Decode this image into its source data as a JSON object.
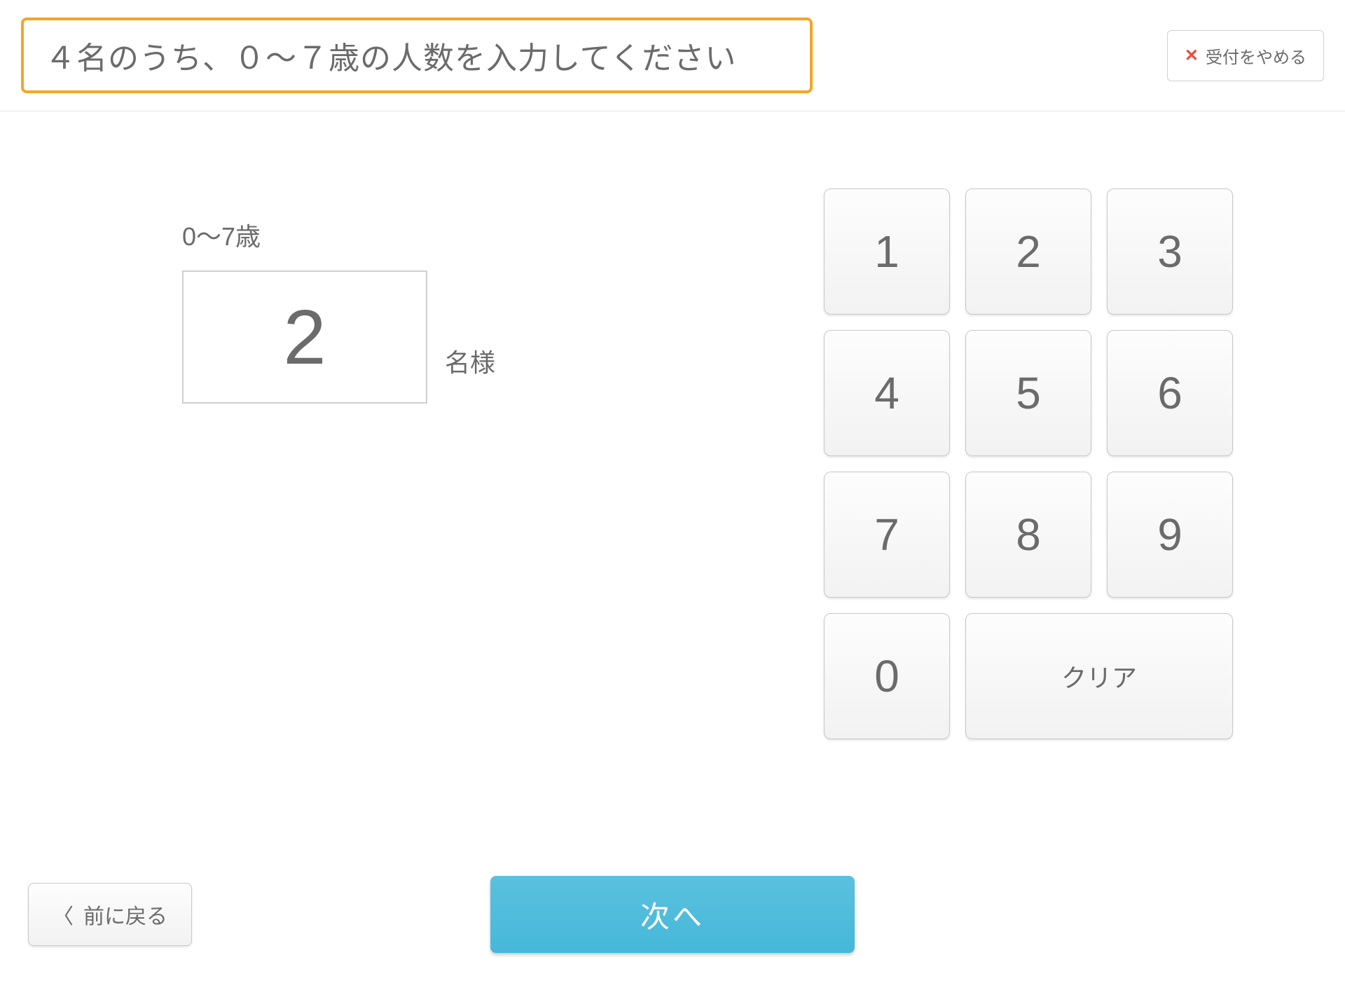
{
  "header": {
    "prompt": "４名のうち、０〜７歳の人数を入力してください",
    "cancel_label": "受付をやめる"
  },
  "input": {
    "age_label": "0〜7歳",
    "value": "2",
    "suffix": "名様"
  },
  "keypad": {
    "keys": [
      "1",
      "2",
      "3",
      "4",
      "5",
      "6",
      "7",
      "8",
      "9",
      "0"
    ],
    "clear_label": "クリア"
  },
  "footer": {
    "back_label": "前に戻る",
    "next_label": "次へ"
  }
}
